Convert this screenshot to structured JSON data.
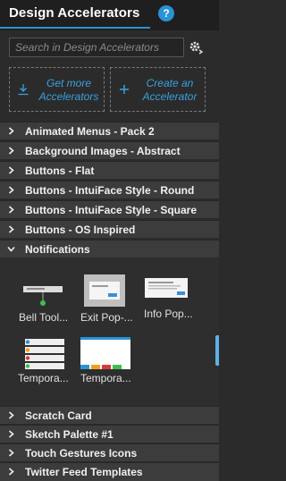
{
  "header": {
    "title": "Design Accelerators",
    "help_glyph": "?"
  },
  "search": {
    "placeholder": "Search in Design Accelerators"
  },
  "actions": {
    "get_more": "Get more Accelerators",
    "create": "Create an Accelerator"
  },
  "categories_top": [
    "Animated Menus - Pack 2",
    "Background Images - Abstract",
    "Buttons - Flat",
    "Buttons - IntuiFace Style - Round",
    "Buttons - IntuiFace Style - Square",
    "Buttons - OS Inspired",
    "Notifications"
  ],
  "notifications_items": [
    "Bell Tool...",
    "Exit Pop-...",
    "Info Pop...",
    "Tempora...",
    "Tempora..."
  ],
  "categories_bottom": [
    "Scratch Card",
    "Sketch Palette #1",
    "Touch Gestures Icons",
    "Twitter Feed Templates"
  ],
  "colors": {
    "accent": "#2a93d5",
    "row_bg": "#3c3c3c",
    "panel_bg": "#2b2b2b"
  }
}
